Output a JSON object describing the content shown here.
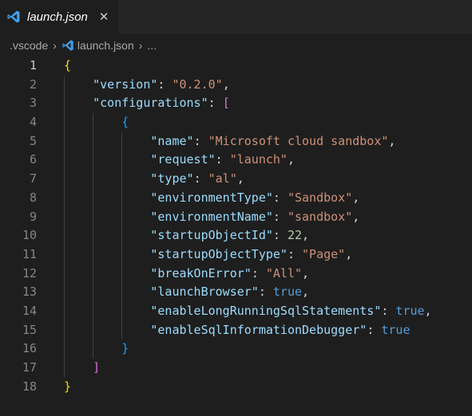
{
  "tab": {
    "title": "launch.json",
    "close": "✕",
    "icon": "vscode-icon"
  },
  "breadcrumb": {
    "folder": ".vscode",
    "file": "launch.json",
    "more": "..."
  },
  "colors": {
    "key": "#9cdcfe",
    "string": "#ce9178",
    "number": "#b5cea8",
    "bool": "#569cd6",
    "brace": "#ffd700",
    "bracket": "#da70d6",
    "inner_brace": "#179fff"
  },
  "editor": {
    "active_line": 1,
    "lines": [
      {
        "n": "1",
        "text": "{"
      },
      {
        "n": "2",
        "text": "\"version\": \"0.2.0\","
      },
      {
        "n": "3",
        "text": "\"configurations\": ["
      },
      {
        "n": "4",
        "text": "{"
      },
      {
        "n": "5",
        "text": "\"name\": \"Microsoft cloud sandbox\","
      },
      {
        "n": "6",
        "text": "\"request\": \"launch\","
      },
      {
        "n": "7",
        "text": "\"type\": \"al\","
      },
      {
        "n": "8",
        "text": "\"environmentType\": \"Sandbox\","
      },
      {
        "n": "9",
        "text": "\"environmentName\": \"sandbox\","
      },
      {
        "n": "10",
        "text": "\"startupObjectId\": 22,"
      },
      {
        "n": "11",
        "text": "\"startupObjectType\": \"Page\","
      },
      {
        "n": "12",
        "text": "\"breakOnError\": \"All\","
      },
      {
        "n": "13",
        "text": "\"launchBrowser\": true,"
      },
      {
        "n": "14",
        "text": "\"enableLongRunningSqlStatements\": true,"
      },
      {
        "n": "15",
        "text": "\"enableSqlInformationDebugger\": true"
      },
      {
        "n": "16",
        "text": "}"
      },
      {
        "n": "17",
        "text": "]"
      },
      {
        "n": "18",
        "text": "}"
      }
    ]
  }
}
